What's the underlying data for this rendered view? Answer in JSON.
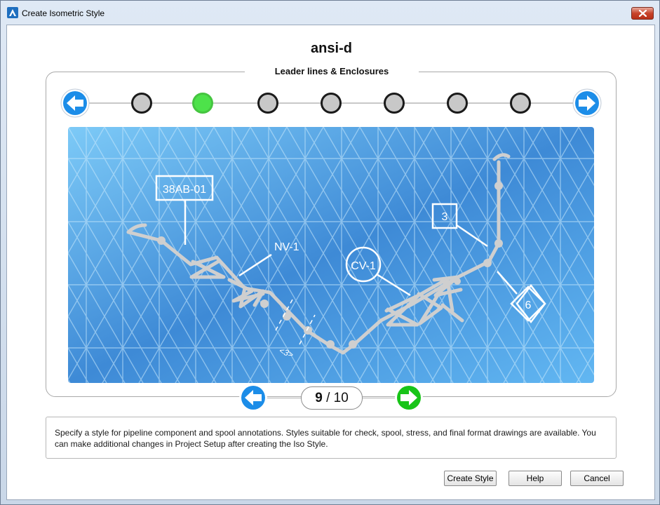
{
  "window": {
    "title": "Create Isometric Style"
  },
  "style_name": "ansi-d",
  "section": {
    "title": "Leader lines & Enclosures"
  },
  "stepper": {
    "total_dots": 8,
    "active_index": 1
  },
  "preview": {
    "labels": {
      "tag": "38AB-01",
      "valve": "NV-1",
      "check_valve": "CV-1",
      "box_number": "3",
      "diamond_number": "6",
      "dim": "<3>"
    },
    "colors": {
      "background_start": "#7dcaf7",
      "background_end": "#3e8ad6",
      "pipe": "#cfcfcf",
      "annotation": "#ffffff"
    }
  },
  "pager": {
    "current": "9",
    "separator": "/",
    "total": "10"
  },
  "description": "Specify a style for pipeline component and spool annotations. Styles suitable for check, spool, stress, and final format drawings are available. You can make additional changes in Project Setup after creating the Iso Style.",
  "buttons": {
    "create": "Create Style",
    "help": "Help",
    "cancel": "Cancel"
  },
  "icons": {
    "prev": "arrow-left-icon",
    "next": "arrow-right-icon",
    "close": "close-icon",
    "app": "app-logo-icon"
  },
  "colors": {
    "active_step": "#4de24a",
    "inactive_step": "#c8c8c8",
    "nav_blue": "#1c8de8",
    "nav_green": "#18c418",
    "close_red": "#c7432a"
  }
}
